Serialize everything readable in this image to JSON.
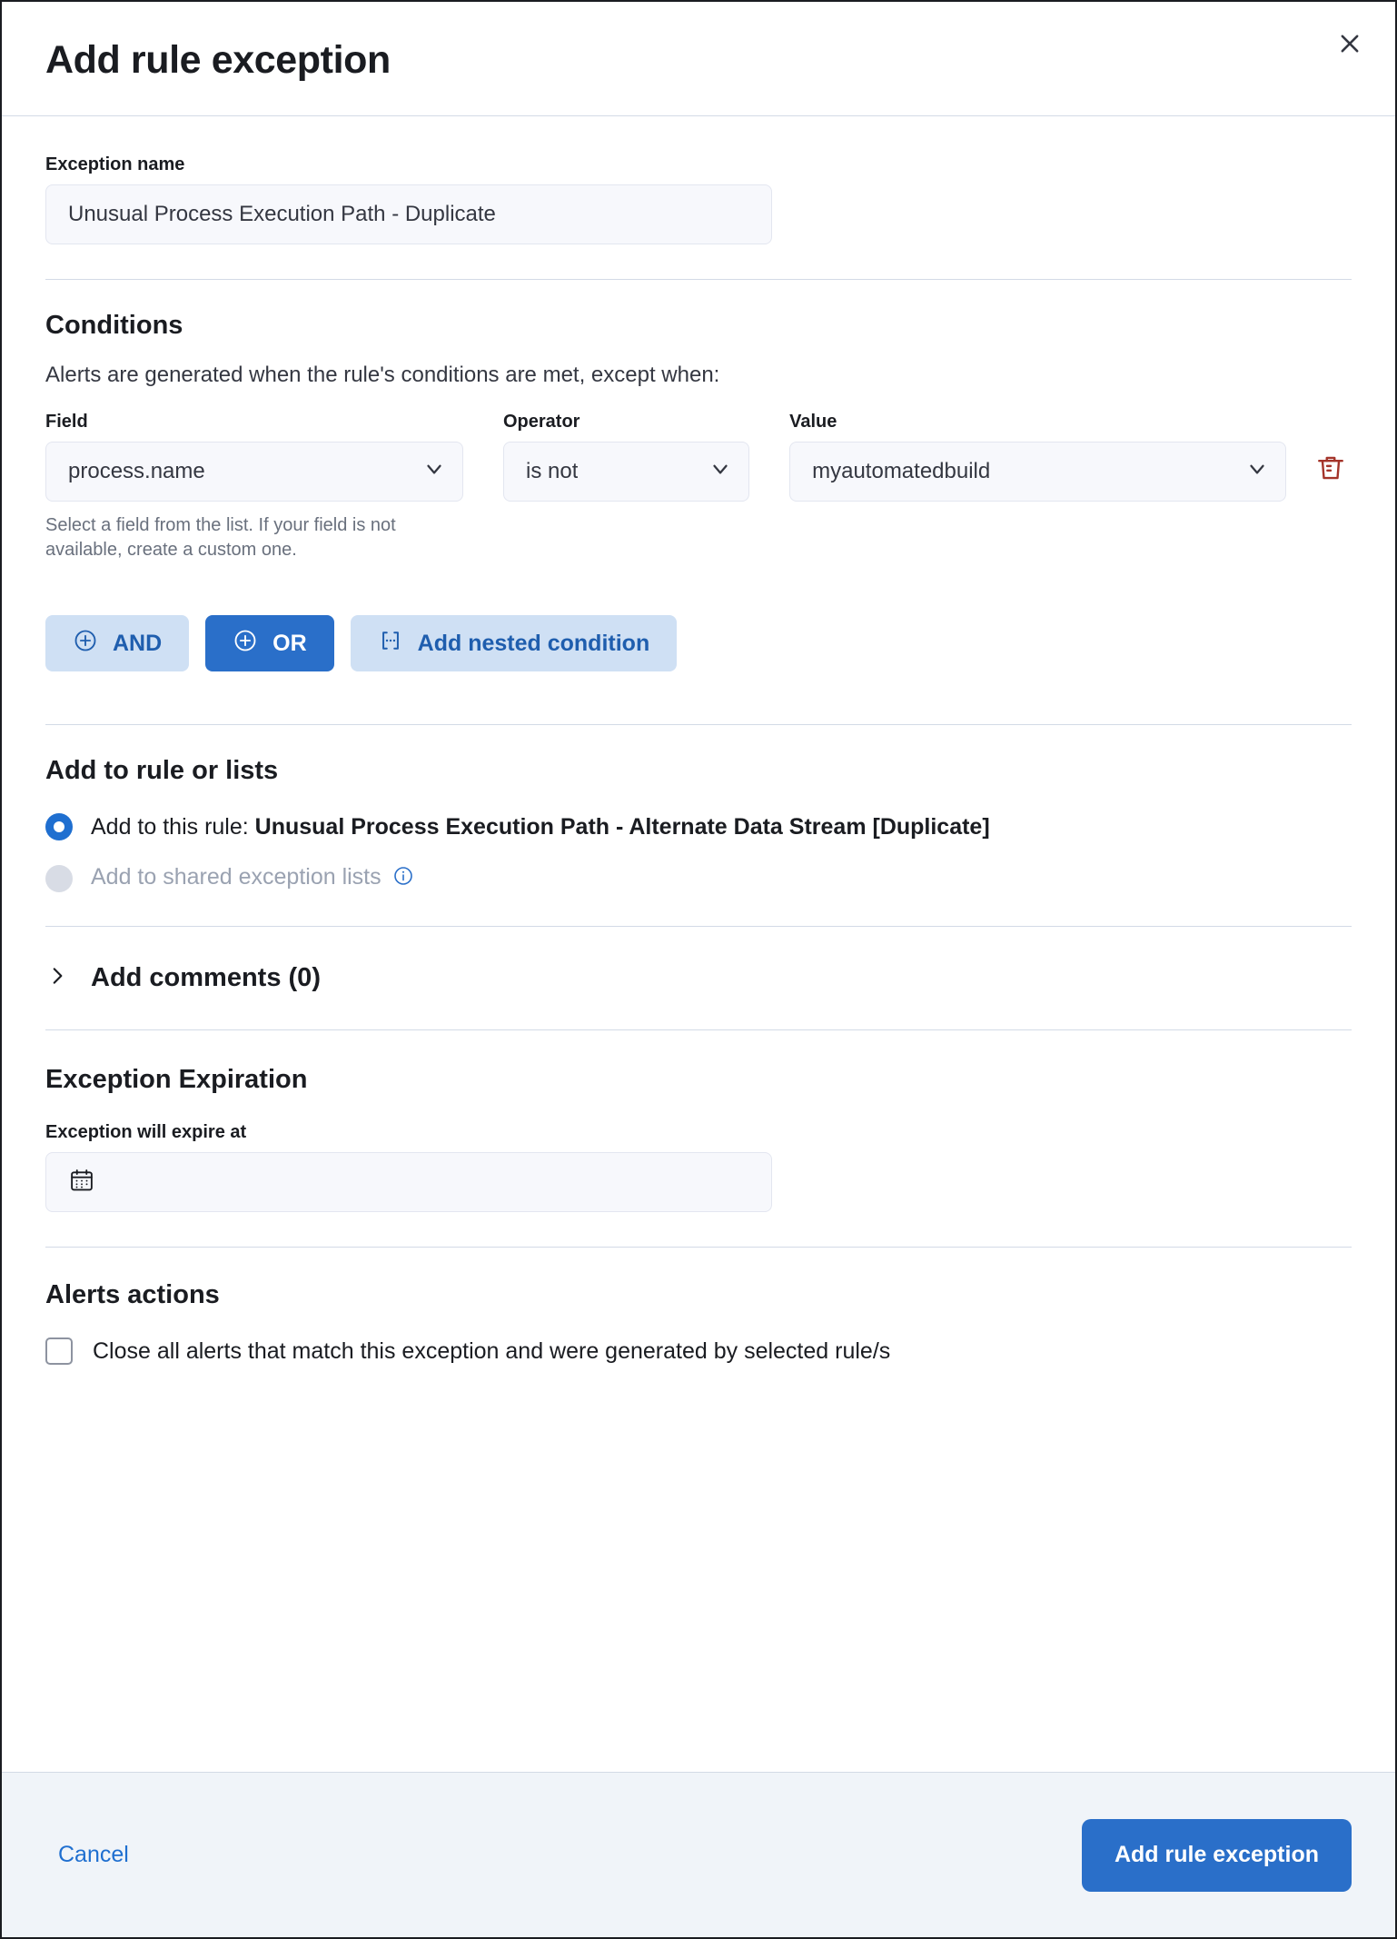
{
  "header": {
    "title": "Add rule exception",
    "close_icon": "close-icon"
  },
  "exception_name": {
    "label": "Exception name",
    "value": "Unusual Process Execution Path - Duplicate"
  },
  "conditions": {
    "title": "Conditions",
    "description": "Alerts are generated when the rule's conditions are met, except when:",
    "columns": {
      "field": "Field",
      "operator": "Operator",
      "value": "Value"
    },
    "row": {
      "field_value": "process.name",
      "operator_value": "is not",
      "value_value": "myautomatedbuild",
      "field_help": "Select a field from the list. If your field is not available, create a custom one.",
      "delete_icon": "trash-icon"
    },
    "buttons": {
      "and": "AND",
      "or": "OR",
      "nested": "Add nested condition",
      "and_icon": "plus-circle-icon",
      "or_icon": "plus-circle-icon",
      "nested_icon": "nested-brackets-icon"
    }
  },
  "add_to": {
    "title": "Add to rule or lists",
    "option_rule_prefix": "Add to this rule: ",
    "option_rule_name": "Unusual Process Execution Path - Alternate Data Stream [Duplicate]",
    "option_shared": "Add to shared exception lists",
    "info_icon": "info-icon",
    "selected": "rule"
  },
  "comments": {
    "title": "Add comments (0)",
    "chevron_icon": "chevron-right-icon",
    "expanded": false
  },
  "expiration": {
    "title": "Exception Expiration",
    "label": "Exception will expire at",
    "value": "",
    "calendar_icon": "calendar-icon"
  },
  "alerts_actions": {
    "title": "Alerts actions",
    "checkbox_label": "Close all alerts that match this exception and were generated by selected rule/s",
    "checked": false
  },
  "footer": {
    "cancel": "Cancel",
    "submit": "Add rule exception"
  },
  "colors": {
    "primary": "#2a6fc9",
    "link": "#1f6fd0",
    "pill_light_bg": "#cfe0f4",
    "pill_light_text": "#1f5eae",
    "danger": "#a4342a",
    "muted_text": "#69707d",
    "footer_bg": "#f0f4f9",
    "input_bg": "#f7f8fc",
    "border": "#d3dae6"
  }
}
